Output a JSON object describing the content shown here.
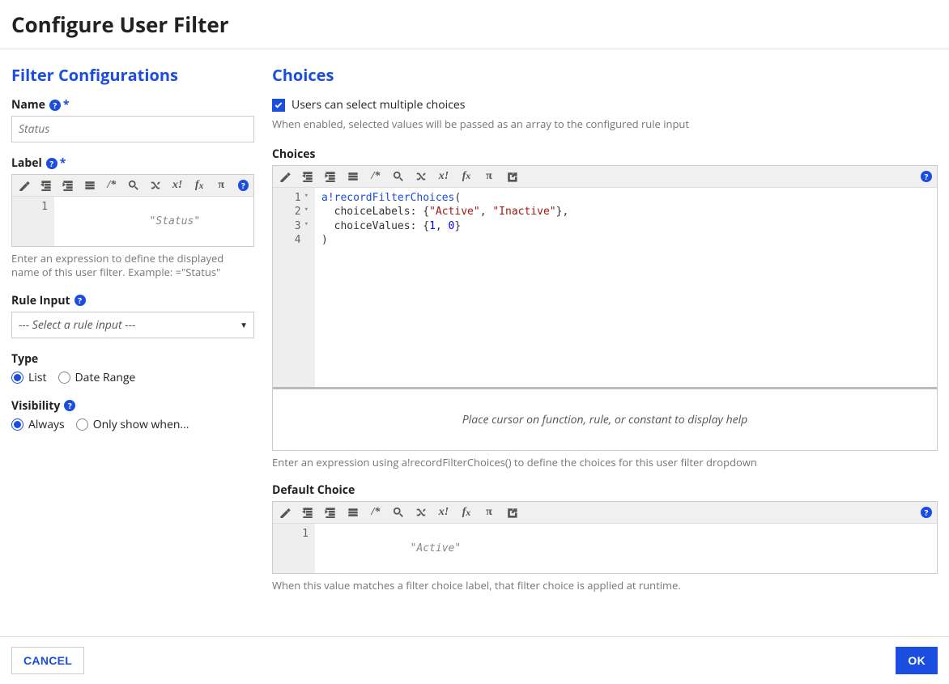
{
  "title": "Configure User Filter",
  "left": {
    "heading": "Filter Configurations",
    "name": {
      "label": "Name",
      "placeholder": "Status"
    },
    "labelField": {
      "label": "Label",
      "code_placeholder": "\"Status\"",
      "helper": "Enter an expression to define the displayed name of this user filter. Example: =\"Status\""
    },
    "ruleInput": {
      "label": "Rule Input",
      "placeholder": "--- Select a rule input ---"
    },
    "type": {
      "label": "Type",
      "options": [
        "List",
        "Date Range"
      ],
      "selected": "List"
    },
    "visibility": {
      "label": "Visibility",
      "options": [
        "Always",
        "Only show when..."
      ],
      "selected": "Always"
    }
  },
  "right": {
    "heading": "Choices",
    "multi_label": "Users can select multiple choices",
    "multi_helper": "When enabled, selected values will be passed as an array to the configured rule input",
    "choices_label": "Choices",
    "choices_code_tokens": [
      [
        {
          "t": "a!recordFilterChoices",
          "c": "kw"
        },
        {
          "t": "(",
          "c": ""
        }
      ],
      [
        {
          "t": "  choiceLabels",
          "c": "key"
        },
        {
          "t": ": {",
          "c": ""
        },
        {
          "t": "\"Active\"",
          "c": "str"
        },
        {
          "t": ", ",
          "c": ""
        },
        {
          "t": "\"Inactive\"",
          "c": "str"
        },
        {
          "t": "},",
          "c": ""
        }
      ],
      [
        {
          "t": "  choiceValues",
          "c": "key"
        },
        {
          "t": ": {",
          "c": ""
        },
        {
          "t": "1",
          "c": "num"
        },
        {
          "t": ", ",
          "c": ""
        },
        {
          "t": "0",
          "c": "num"
        },
        {
          "t": "}",
          "c": ""
        }
      ],
      [
        {
          "t": ")",
          "c": ""
        }
      ]
    ],
    "choices_help_band": "Place cursor on function, rule, or constant to display help",
    "choices_helper": "Enter an expression using a!recordFilterChoices() to define the choices for this user filter dropdown",
    "default_choice_label": "Default Choice",
    "default_choice_placeholder": "\"Active\"",
    "default_choice_helper": "When this value matches a filter choice label, that filter choice is applied at runtime."
  },
  "footer": {
    "cancel": "CANCEL",
    "ok": "OK"
  },
  "icons": {
    "wand": "magic-wand-icon",
    "outdent": "outdent-icon",
    "indent": "indent-icon",
    "format": "format-icon",
    "comment": "comment-icon",
    "search": "search-icon",
    "shuffle": "shuffle-icon",
    "clearvar": "clear-var-icon",
    "fx": "fx-icon",
    "pi": "pi-icon",
    "export": "export-icon",
    "help": "help-icon"
  }
}
